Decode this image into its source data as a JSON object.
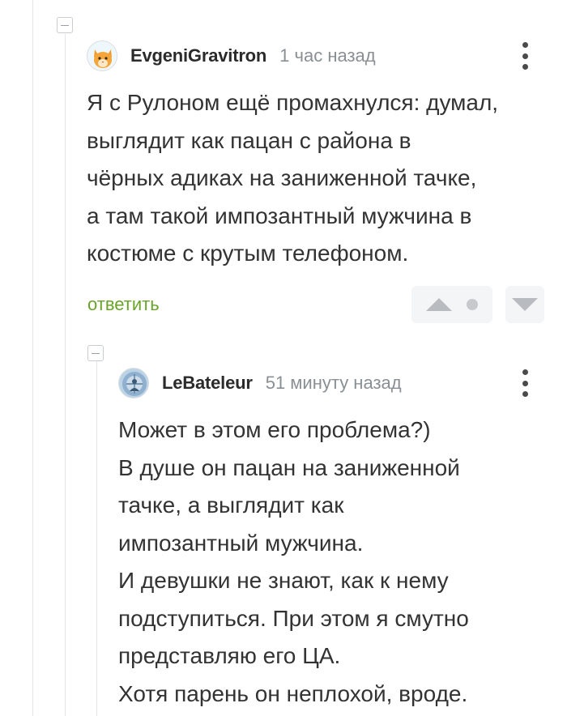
{
  "comment1": {
    "username": "EvgeniGravitron",
    "time": "1 час назад",
    "avatar_icon": "cat-avatar-icon",
    "body": [
      "Я с Рулоном ещё промахнулся: думал,",
      "выглядит как пацан с района в",
      "чёрных адиках на заниженной тачке,",
      "а там такой импозантный мужчина в",
      "костюме с крутым телефоном."
    ],
    "reply_label": "ответить"
  },
  "comment2": {
    "username": "LeBateleur",
    "time": "51 минуту назад",
    "avatar_icon": "tarot-avatar-icon",
    "body": [
      "Может в этом его проблема?)",
      "В душе он пацан на заниженной",
      "тачке, а выглядит как",
      "импозантный мужчина.",
      "И девушки не знают, как к нему",
      "подступиться. При этом я смутно",
      "представляю его ЦА.",
      "Хотя парень он неплохой, вроде."
    ]
  },
  "colors": {
    "accent_green": "#69a329",
    "thread_line": "#e3e5e7",
    "vote_bg": "#f4f5f6",
    "vote_icon": "#b8bcc1"
  }
}
